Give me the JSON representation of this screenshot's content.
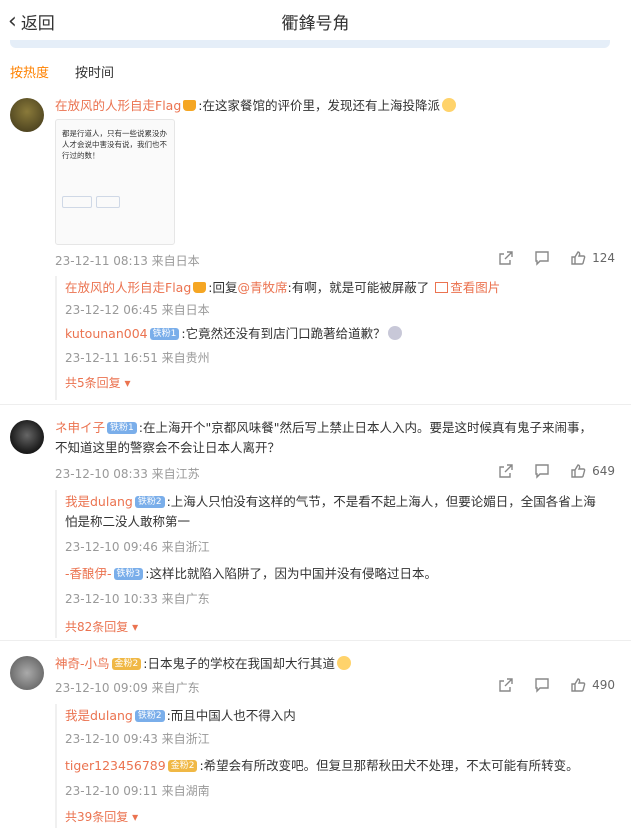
{
  "header": {
    "back_label": "返回",
    "title": "衢鋒号角"
  },
  "sort": {
    "hot": "按热度",
    "time": "按时间"
  },
  "colors": {
    "accent": "#ff8200",
    "name": "#eb7350"
  },
  "comments": [
    {
      "name": "在放风的人形自走Flag",
      "text": ":在这家餐馆的评价里，发现还有上海投降派",
      "image_caption": "都是行道人，只有一些说累没办人才会说中害没有说，我们也不行过的数！",
      "time": "23-12-11 08:13 来自日本",
      "likes": "124",
      "replies": [
        {
          "name": "在放风的人形自走Flag",
          "reply_prefix": ":回复",
          "reply_to": "@青牧席",
          "text": ":有啊，就是可能被屏蔽了",
          "view_image": "查看图片",
          "time": "23-12-12 06:45 来自日本"
        },
        {
          "name": "kutounan004",
          "badge": "铁粉1",
          "text": ":它竟然还没有到店门口跪著给道歉？",
          "time": "23-12-11 16:51 来自贵州"
        }
      ],
      "more": "共5条回复"
    },
    {
      "name": "ネ申イ子",
      "badge": "铁粉1",
      "text": ":在上海开个\"京都风味餐\"然后写上禁止日本人入内。要是这时候真有鬼子来闹事，不知道这里的警察会不会让日本人离开？",
      "time": "23-12-10 08:33 来自江苏",
      "likes": "649",
      "replies": [
        {
          "name": "我是dulang",
          "badge": "铁粉2",
          "text": ":上海人只怕没有这样的气节，不是看不起上海人，但要论媚日，全国各省上海怕是称二没人敢称第一",
          "time": "23-12-10 09:46 来自浙江"
        },
        {
          "name": "-香酿伊-",
          "badge": "铁粉3",
          "text": ":这样比就陷入陷阱了，因为中国并没有侵略过日本。",
          "time": "23-12-10 10:33 来自广东"
        }
      ],
      "more": "共82条回复"
    },
    {
      "name": "神奇-小鸟",
      "badge": "金粉2",
      "text": ":日本鬼子的学校在我国却大行其道",
      "time": "23-12-10 09:09 来自广东",
      "likes": "490",
      "replies": [
        {
          "name": "我是dulang",
          "badge": "铁粉2",
          "text": ":而且中国人也不得入内",
          "time": "23-12-10 09:43 来自浙江"
        },
        {
          "name": "tiger123456789",
          "badge": "金粉2",
          "text": ":希望会有所改变吧。但复旦那帮秋田犬不处理，不太可能有所转变。",
          "time": "23-12-10 09:11 来自湖南"
        }
      ],
      "more": "共39条回复"
    }
  ]
}
